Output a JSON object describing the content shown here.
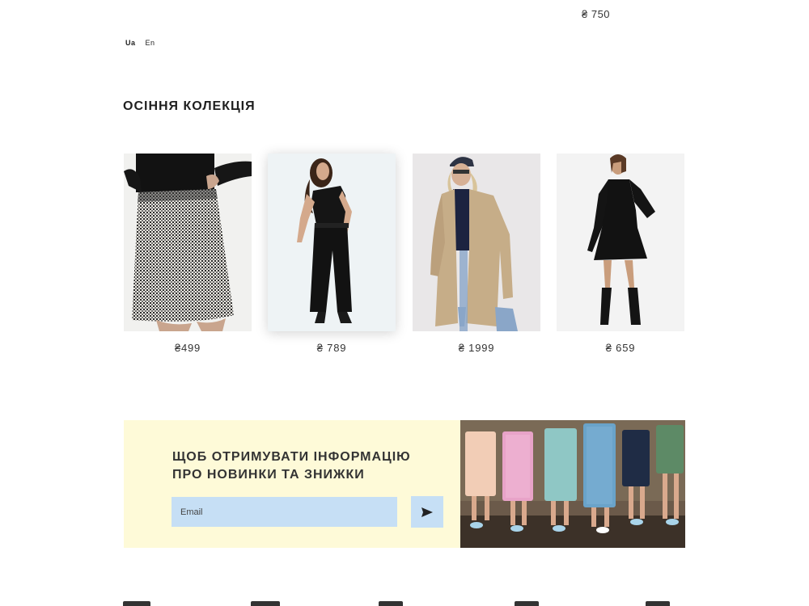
{
  "header": {
    "top_price": "₴ 750",
    "languages": [
      {
        "label": "Ua",
        "active": true
      },
      {
        "label": "En",
        "active": false
      }
    ]
  },
  "collection": {
    "title": "ОСІННЯ КОЛЕКЦІЯ",
    "products": [
      {
        "price": "₴499",
        "image": "checked-skirt"
      },
      {
        "price": "₴ 789",
        "image": "black-jumpsuit"
      },
      {
        "price": "₴ 1999",
        "image": "beige-trench-coat"
      },
      {
        "price": "₴ 659",
        "image": "black-dress"
      }
    ]
  },
  "newsletter": {
    "title_line1": "ЩОБ ОТРИМУВАТИ ІНФОРМАЦІЮ",
    "title_line2": "ПРО НОВИНКИ ТА ЗНИЖКИ",
    "email_placeholder": "Email",
    "send_icon": "send-arrow-icon",
    "image": "girls-in-summer-dresses"
  },
  "colors": {
    "newsletter_bg": "#fefad8",
    "input_bg": "#c6dff5",
    "text": "#222222"
  }
}
